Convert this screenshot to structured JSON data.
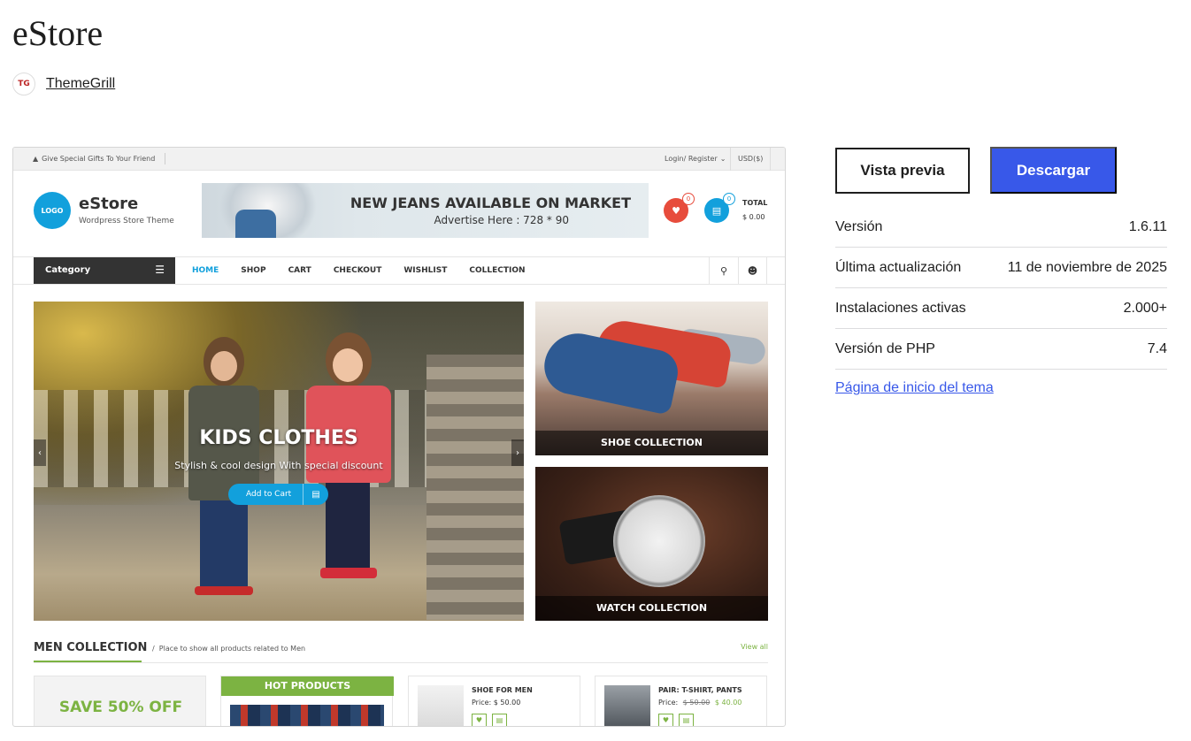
{
  "theme": {
    "title": "eStore",
    "author": {
      "name": "ThemeGrill",
      "avatar_text": "TG"
    }
  },
  "preview": {
    "topbar": {
      "gift_text": "Give Special Gifts To Your Friend",
      "login": "Login/ Register",
      "currency": "USD($)"
    },
    "header": {
      "logo_text": "LOGO",
      "site_name": "eStore",
      "tagline": "Wordpress Store Theme",
      "banner_title": "NEW JEANS AVAILABLE ON MARKET",
      "banner_sub": "Advertise Here : 728 * 90",
      "wishlist_count": "0",
      "cart_count": "0",
      "total_label": "TOTAL",
      "total_value": "$ 0.00"
    },
    "nav": {
      "category": "Category",
      "items": [
        "HOME",
        "SHOP",
        "CART",
        "CHECKOUT",
        "WISHLIST",
        "COLLECTION"
      ]
    },
    "hero": {
      "title": "KIDS CLOTHES",
      "subtitle": "Stylish & cool design With special discount",
      "button": "Add to Cart"
    },
    "tiles": {
      "shoe": "SHOE COLLECTION",
      "watch": "WATCH COLLECTION"
    },
    "section": {
      "title": "MEN COLLECTION",
      "description": "Place to show all products related to Men",
      "view_all": "View all"
    },
    "promo": "SAVE 50% OFF",
    "hot_products": "HOT PRODUCTS",
    "products": [
      {
        "name": "SHOE FOR MEN",
        "price_label": "Price:",
        "price": "$ 50.00",
        "old_price": ""
      },
      {
        "name": "PAIR: T-SHIRT, PANTS",
        "price_label": "Price:",
        "price": "$ 40.00",
        "old_price": "$ 50.00"
      }
    ]
  },
  "actions": {
    "preview": "Vista previa",
    "download": "Descargar"
  },
  "meta": [
    {
      "label": "Versión",
      "value": "1.6.11"
    },
    {
      "label": "Última actualización",
      "value": "11 de noviembre de 2025"
    },
    {
      "label": "Instalaciones activas",
      "value": "2.000+"
    },
    {
      "label": "Versión de PHP",
      "value": "7.4"
    }
  ],
  "homepage_link": "Página de inicio del tema",
  "colors": {
    "primary_button": "#3858e9",
    "accent_blue": "#12a0dc",
    "accent_green": "#7cb342",
    "accent_red": "#e74c3c"
  }
}
